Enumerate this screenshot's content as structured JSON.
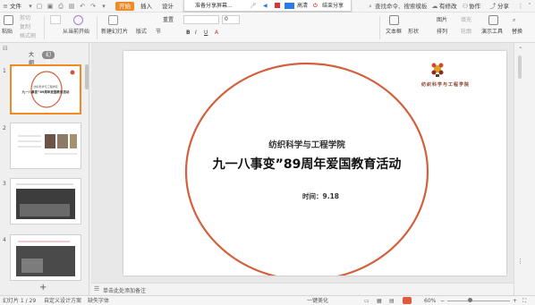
{
  "menubar": {
    "file": "文件",
    "tabs": [
      "开始",
      "插入",
      "设计"
    ],
    "search": "查找命令、搜索模板",
    "unmodified": "有修改",
    "collab": "协作",
    "share": "分享"
  },
  "sharebar": {
    "prepare": "准备分享屏幕...",
    "hd": "高清",
    "end": "结束分享"
  },
  "ribbon": {
    "paste": "粘贴",
    "cut": "剪切",
    "copy": "复制",
    "format_painter": "格式刷",
    "from_current": "从当前开始",
    "new_slide": "新建幻灯片",
    "layout": "版式",
    "section": "节",
    "reset": "重置",
    "textbox": "文本框",
    "shape": "形状",
    "arrange": "排列",
    "picture": "图片",
    "fill": "填充",
    "outline": "轮廓",
    "present_tools": "演示工具",
    "replace": "替换",
    "font_size": "0"
  },
  "leftpanel": {
    "tab_outline": "大纲",
    "tab_slides": "幻灯片",
    "slide_numbers": [
      "1",
      "2",
      "3",
      "4"
    ],
    "add": "+"
  },
  "slide": {
    "school": "纺织科学与工程学院",
    "title": "九一八事变”89周年爱国教育活动",
    "time": "时间：9.18",
    "logo_text": "纺织科学与工程学院",
    "accent": "#d2603c"
  },
  "thumb1": {
    "school": "纺织科学与工程学院",
    "title": "九一八事变”89周年爱国教育活动"
  },
  "notes": {
    "placeholder": "单击此处添加备注"
  },
  "statusbar": {
    "slide_count": "幻灯片 1 / 29",
    "template": "自定义设计方案",
    "font_missing": "缺失字体",
    "beautify": "一键美化",
    "zoom": "60%"
  },
  "colors": {
    "accent": "#f08a24",
    "ring": "#d2603c"
  }
}
